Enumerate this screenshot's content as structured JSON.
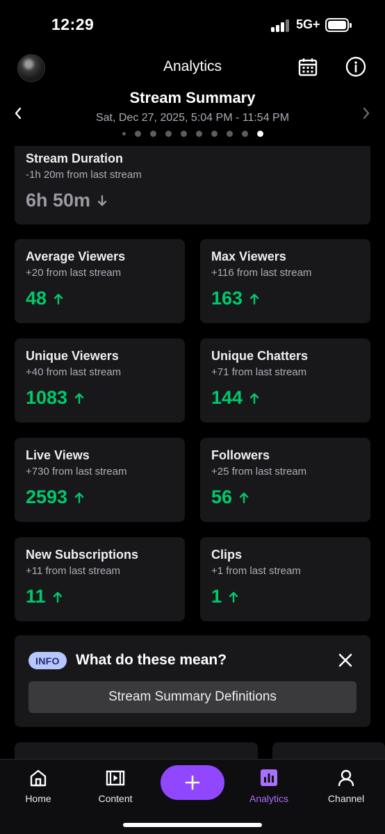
{
  "status_bar": {
    "time": "12:29",
    "network": "5G+"
  },
  "header": {
    "title": "Analytics",
    "summary_title": "Stream Summary",
    "date_range": "Sat, Dec 27, 2025, 5:04 PM - 11:54 PM"
  },
  "pager": {
    "count": 10,
    "active_index": 9
  },
  "duration": {
    "label": "Stream Duration",
    "sub": "-1h 20m from last stream",
    "value": "6h 50m",
    "trend": "down"
  },
  "stats": [
    {
      "label": "Average Viewers",
      "sub": "+20 from last stream",
      "value": "48",
      "trend": "up"
    },
    {
      "label": "Max Viewers",
      "sub": "+116 from last stream",
      "value": "163",
      "trend": "up"
    },
    {
      "label": "Unique Viewers",
      "sub": "+40 from last stream",
      "value": "1083",
      "trend": "up"
    },
    {
      "label": "Unique Chatters",
      "sub": "+71 from last stream",
      "value": "144",
      "trend": "up"
    },
    {
      "label": "Live Views",
      "sub": "+730 from last stream",
      "value": "2593",
      "trend": "up"
    },
    {
      "label": "Followers",
      "sub": "+25 from last stream",
      "value": "56",
      "trend": "up"
    },
    {
      "label": "New Subscriptions",
      "sub": "+11 from last stream",
      "value": "11",
      "trend": "up"
    },
    {
      "label": "Clips",
      "sub": "+1 from last stream",
      "value": "1",
      "trend": "up"
    }
  ],
  "info_box": {
    "badge": "INFO",
    "question": "What do these mean?",
    "button": "Stream Summary Definitions"
  },
  "bottom_nav": {
    "home": "Home",
    "content": "Content",
    "analytics": "Analytics",
    "channel": "Channel",
    "active": "analytics"
  },
  "colors": {
    "accent": "#9147ff",
    "up": "#00c96b",
    "card": "#18181b",
    "active_tab": "#a970ff"
  }
}
